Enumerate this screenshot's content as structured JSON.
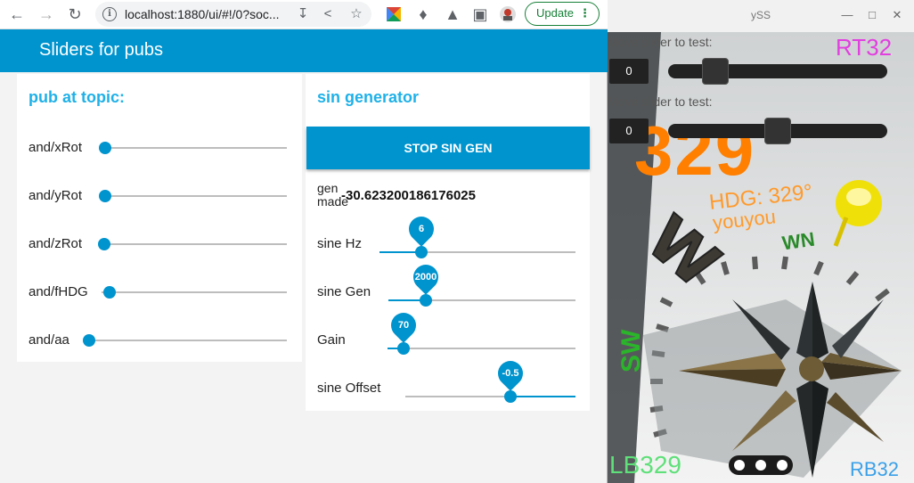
{
  "browser": {
    "url": "localhost:1880/ui/#!/0?soc...",
    "update_label": "Update"
  },
  "app": {
    "title": "Sliders for pubs"
  },
  "left_panel": {
    "title": "pub at topic:",
    "rows": [
      {
        "label": "and/xRot",
        "level": 0
      },
      {
        "label": "and/yRot",
        "level": 0
      },
      {
        "label": "and/zRot",
        "level": 0
      },
      {
        "label": "and/fHDG",
        "level": 0.03
      },
      {
        "label": "and/aa",
        "level": 0
      }
    ]
  },
  "right_panel": {
    "title": "sin generator",
    "stop_button": "STOP SIN GEN",
    "gen_made_label": "gen made",
    "gen_made_value": "-30.623200186176025",
    "sliders": [
      {
        "label": "sine Hz",
        "value": "6"
      },
      {
        "label": "sine Gen",
        "value": "2000"
      },
      {
        "label": "Gain",
        "value": "70"
      },
      {
        "label": "sine Offset",
        "value": "-0.5"
      }
    ]
  },
  "yss": {
    "title": "ySS",
    "slider1_label": "Move slider to test:",
    "slider1_value": "0",
    "slider2_label": "Move slider to test:",
    "slider2_value": "0",
    "big_heading": "329",
    "hdg_text": "HDG: 329°",
    "name_text": "youyou",
    "wn_text": "WN",
    "sw_text": "SW",
    "rt_text": "RT32",
    "lb_text": "LB329",
    "rb_text": "RB32"
  },
  "colors": {
    "accent": "#0094ce",
    "title_blue": "#1fb1e8",
    "update_green": "#188038",
    "orange": "#ff7f00",
    "magenta": "#e23fe0"
  }
}
